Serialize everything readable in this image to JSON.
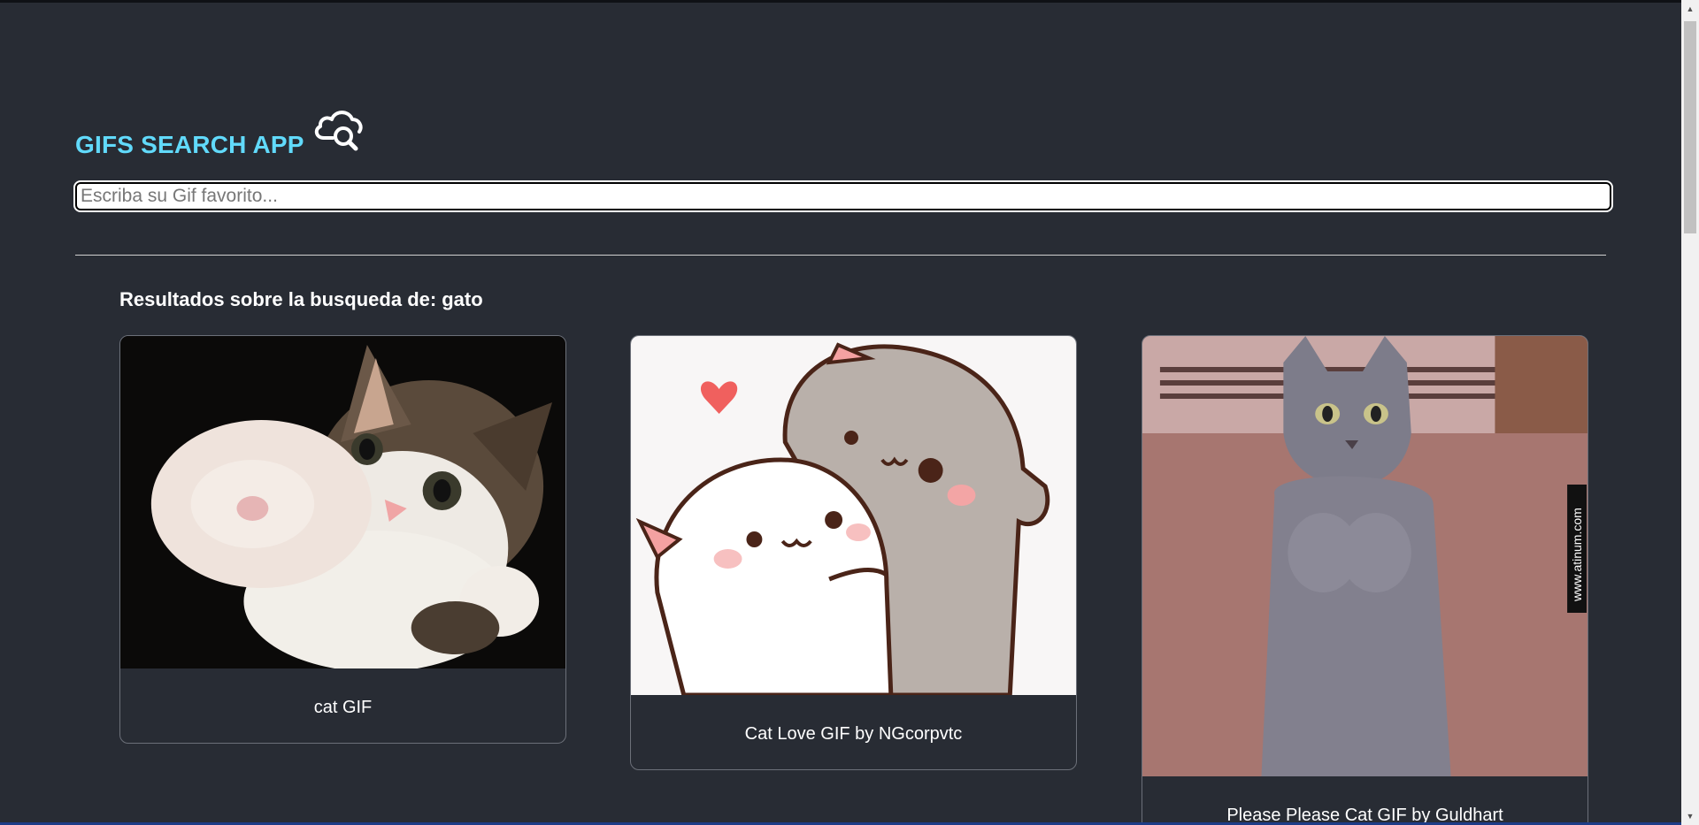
{
  "header": {
    "title": "GIFS SEARCH APP",
    "logo_icon": "cloud-search-icon"
  },
  "search": {
    "placeholder": "Escriba su Gif favorito...",
    "value": ""
  },
  "results": {
    "heading_prefix": "Resultados sobre la busqueda de:",
    "term": "gato",
    "items": [
      {
        "title": "cat GIF",
        "image": "kitten-reaching-paw"
      },
      {
        "title": "Cat Love GIF by NGcorpvtc",
        "image": "cartoon-cats-hugging"
      },
      {
        "title": "Please Please Cat GIF by Guldhart",
        "image": "grey-cat-begging",
        "watermark": "www.atinum.com"
      }
    ]
  },
  "colors": {
    "background": "#282c34",
    "accent": "#61dafb",
    "card_border": "#6c7079"
  }
}
